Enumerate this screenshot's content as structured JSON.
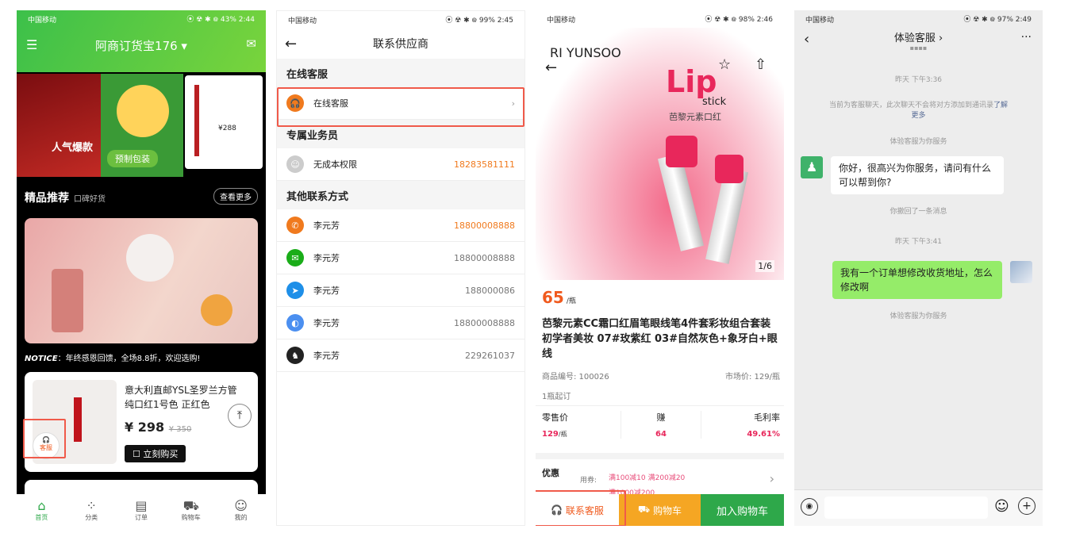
{
  "s1": {
    "status_left": "中国移动",
    "status_right": "⦿ ☢ ✱ ᪤ 43% 2:44",
    "title": "阿商订货宝176 ▾",
    "banner_text1": "人气爆款",
    "banner_text2": "预制包装",
    "banner_text3": "¥288",
    "section_title": "精品推荐",
    "section_sub": "口碑好货",
    "more": "查看更多",
    "notice_label": "NOTICE",
    "notice_text": "：年终感恩回馈，全场8.8折，欢迎选购!",
    "product_name": "意大利直邮YSL圣罗兰方管纯口红1号色 正红色",
    "product_price": "¥ 298",
    "product_old": "¥ 350",
    "buy": "立刻购买",
    "service": "客服",
    "tabs": [
      "首页",
      "分类",
      "订单",
      "购物车",
      "我的"
    ],
    "accent": "#2ea84a"
  },
  "s2": {
    "status_left": "中国移动",
    "status_right": "⦿ ☢ ✱ ᪤ 99% 2:45",
    "title": "联系供应商",
    "g1": "在线客服",
    "online": "在线客服",
    "g2": "专属业务员",
    "sales_name": "无成本权限",
    "sales_phone": "18283581111",
    "g3": "其他联系方式",
    "contacts": [
      {
        "name": "李元芳",
        "value": "18800008888"
      },
      {
        "name": "李元芳",
        "value": "18800008888"
      },
      {
        "name": "李元芳",
        "value": "188000086"
      },
      {
        "name": "李元芳",
        "value": "18800008888"
      },
      {
        "name": "李元芳",
        "value": "229261037"
      }
    ]
  },
  "s3": {
    "status_left": "中国移动",
    "status_right": "⦿ ☢ ✱ ᪤ 98% 2:46",
    "brand": "RI YUNSOO",
    "lip": "Lip",
    "stick": "stick",
    "cn": "芭黎元素口红",
    "page": "1/6",
    "price": "65",
    "unit": "/瓶",
    "title": "芭黎元素CC霜口红眉笔眼线笔4件套彩妆组合套装初学者美妆 07#玫紫红 03#自然灰色+象牙白+眼线",
    "code": "商品编号: 100026",
    "market": "市场价: 129/瓶",
    "min": "1瓶起订",
    "stat_labels": [
      "零售价",
      "赚",
      "毛利率"
    ],
    "stat_values": [
      "129",
      "64",
      "49.61%"
    ],
    "stat_unit": "/瓶",
    "coupon_label": "优惠",
    "coupon_use": "用券:",
    "coupons": [
      "满100减10",
      "满200减20",
      "满1000减200"
    ],
    "btn_service": "联系客服",
    "btn_cart": "购物车",
    "btn_add": "加入购物车"
  },
  "s4": {
    "status_left": "中国移动",
    "status_right": "⦿ ☢ ✱ ᪤ 97% 2:49",
    "title": "体验客服 ›",
    "subtitle": "▪▪▪▪",
    "t1": "昨天 下午3:36",
    "notice1": "当前为客服聊天，此次聊天不会将对方添加到通讯录",
    "notice_link": "了解更多",
    "serving": "体验客服为你服务",
    "msg1": "你好，很高兴为你服务，请问有什么可以帮到你?",
    "recall": "你撤回了一条消息",
    "t2": "昨天 下午3:41",
    "msg2": "我有一个订单想修改收货地址，怎么修改啊",
    "serving2": "体验客服为你服务"
  }
}
